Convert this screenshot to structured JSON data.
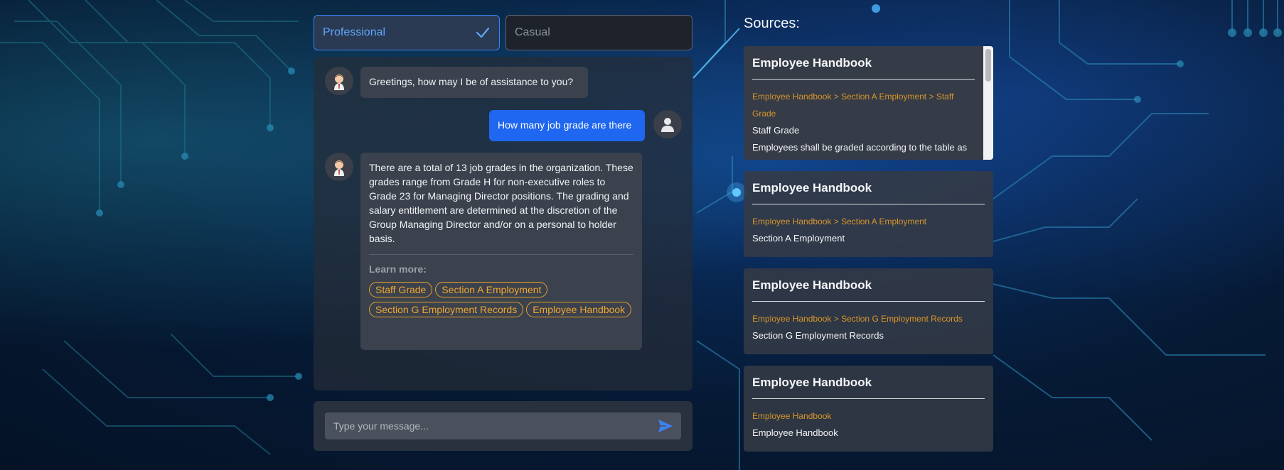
{
  "tone": {
    "active_label": "Professional",
    "inactive_label": "Casual"
  },
  "chat": {
    "messages": [
      {
        "sender": "bot",
        "text": "Greetings, how may I be of assistance to you?"
      },
      {
        "sender": "user",
        "text": "How many job grade are there"
      },
      {
        "sender": "bot",
        "text": "There are a total of 13 job grades in the organization. These grades range from Grade H for non-executive roles to Grade 23 for Managing Director positions. The grading and salary entitlement are determined at the discretion of the Group Managing Director and/or on a personal to holder basis."
      }
    ],
    "learn_more_label": "Learn more:",
    "learn_more_chips": [
      "Staff Grade",
      "Section A Employment",
      "Section G Employment Records",
      "Employee Handbook"
    ]
  },
  "input": {
    "placeholder": "Type your message..."
  },
  "sources": {
    "title": "Sources:",
    "cards": [
      {
        "title": "Employee Handbook",
        "path": "Employee Handbook > Section A Employment > Staff Grade",
        "name": "Staff Grade",
        "snippet": "Employees shall be graded according to the table as"
      },
      {
        "title": "Employee Handbook",
        "path": "Employee Handbook > Section A Employment",
        "name": "Section A Employment"
      },
      {
        "title": "Employee Handbook",
        "path": "Employee Handbook > Section G Employment Records",
        "name": "Section G Employment Records"
      },
      {
        "title": "Employee Handbook",
        "path": "Employee Handbook",
        "name": "Employee Handbook"
      }
    ]
  },
  "colors": {
    "accent_blue": "#3b82f6",
    "user_bubble": "#1f66f0",
    "chip_orange": "#f0a830"
  }
}
